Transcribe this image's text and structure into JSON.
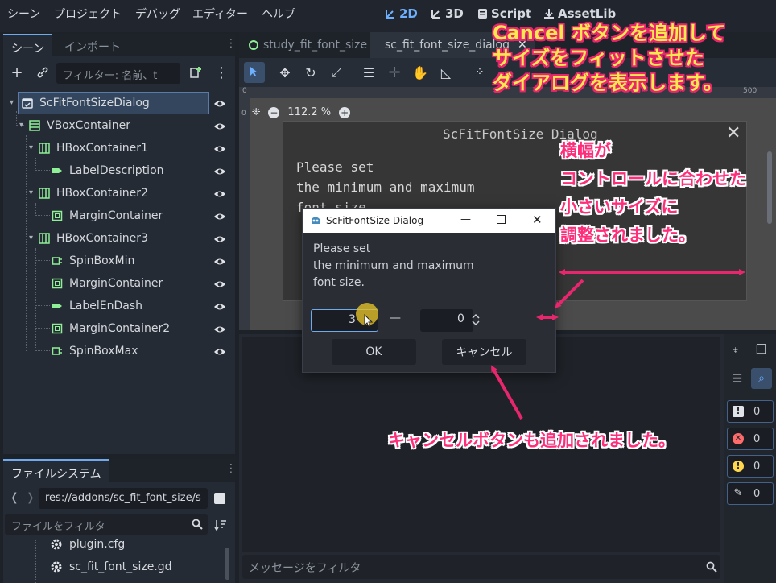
{
  "menubar": {
    "items": [
      "シーン",
      "プロジェクト",
      "デバッグ",
      "エディター",
      "ヘルプ"
    ],
    "workspaces": [
      "2D",
      "3D",
      "Script",
      "AssetLib"
    ],
    "active_workspace": "2D"
  },
  "scene_dock": {
    "tabs": [
      "シーン",
      "インポート"
    ],
    "filter_placeholder": "フィルター: 名前、t",
    "tree": [
      {
        "label": "ScFitFontSizeDialog",
        "icon": "dialog-icon",
        "selected": true
      },
      {
        "label": "VBoxContainer",
        "icon": "vbox-icon"
      },
      {
        "label": "HBoxContainer1",
        "icon": "hbox-icon"
      },
      {
        "label": "LabelDescription",
        "icon": "label-icon"
      },
      {
        "label": "HBoxContainer2",
        "icon": "hbox-icon"
      },
      {
        "label": "MarginContainer",
        "icon": "margin-container-icon"
      },
      {
        "label": "HBoxContainer3",
        "icon": "hbox-icon"
      },
      {
        "label": "SpinBoxMin",
        "icon": "spinbox-icon"
      },
      {
        "label": "MarginContainer",
        "icon": "margin-container-icon"
      },
      {
        "label": "LabelEnDash",
        "icon": "label-icon"
      },
      {
        "label": "MarginContainer2",
        "icon": "margin-container-icon"
      },
      {
        "label": "SpinBoxMax",
        "icon": "spinbox-icon"
      }
    ]
  },
  "filesystem": {
    "tab": "ファイルシステム",
    "path": "res://addons/sc_fit_font_size/s",
    "filter_placeholder": "ファイルをフィルタ",
    "files": [
      "plugin.cfg",
      "sc_fit_font_size.gd"
    ]
  },
  "editor": {
    "tabs": [
      "study_fit_font_size",
      "sc_fit_font_size_dialog"
    ],
    "zoom": "112.2 %",
    "ruler_marks": [
      "0",
      "500"
    ],
    "canvas_dialog_title": "ScFitFontSize Dialog",
    "canvas_dialog_text": [
      "Please set",
      "the minimum and maximum",
      "font size."
    ]
  },
  "bottom_panel": {
    "message_filter_placeholder": "メッセージをフィルタ",
    "counts": [
      "0",
      "0",
      "0",
      "0"
    ]
  },
  "dialog": {
    "title": "ScFitFontSize Dialog",
    "description": [
      "Please set",
      "the minimum and maximum",
      "font size."
    ],
    "min_value": "3",
    "dash": "—",
    "max_value": "0",
    "ok_label": "OK",
    "cancel_label": "キャンセル"
  },
  "annotations": {
    "top": [
      "Cancel ボタンを追加して",
      "サイズをフィットさせた",
      "ダイアログを表示します。"
    ],
    "side": [
      "横幅が",
      "コントロールに合わせた",
      "小さいサイズに",
      "調整されました。"
    ],
    "bottom": "キャンセルボタンも追加されました。"
  },
  "colors": {
    "accent": "#6cb0ff",
    "annotation_yellow": "#ffe94d",
    "annotation_pink": "#ff2e7a"
  }
}
